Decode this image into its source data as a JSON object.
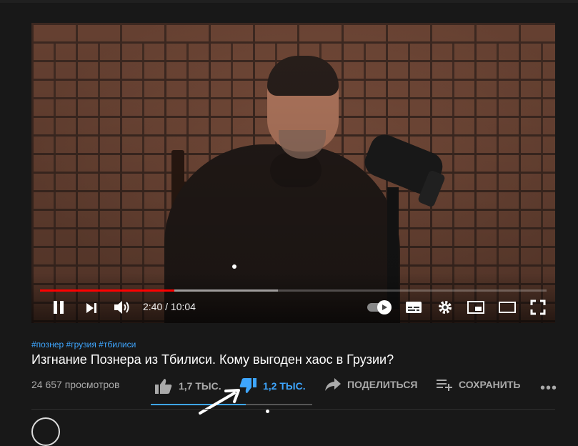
{
  "player": {
    "current_time": "2:40",
    "duration": "10:04",
    "time_display": "2:40 / 10:04",
    "progress_fraction": 0.265,
    "buffered_fraction": 0.47,
    "state": "playing"
  },
  "video": {
    "hashtags": "#познер #грузия #тбилиси",
    "title": "Изгнание Познера из Тбилиси. Кому выгоден хаос в Грузии?",
    "views": "24 657 просмотров"
  },
  "actions": {
    "like_count": "1,7 ТЫС.",
    "dislike_count": "1,2 ТЫС.",
    "share_label": "ПОДЕЛИТЬСЯ",
    "save_label": "СОХРАНИТЬ",
    "more_label": "•••",
    "like_ratio": 0.59
  },
  "colors": {
    "accent": "#3ea6ff",
    "progress": "#ff0000",
    "background": "#181818",
    "muted_text": "#aaaaaa"
  },
  "icons": [
    "pause-icon",
    "next-icon",
    "volume-icon",
    "autoplay-toggle",
    "subtitles-icon",
    "settings-icon",
    "miniplayer-icon",
    "theater-icon",
    "fullscreen-icon",
    "thumb-up-icon",
    "thumb-down-icon",
    "share-icon",
    "save-playlist-icon",
    "more-icon"
  ]
}
